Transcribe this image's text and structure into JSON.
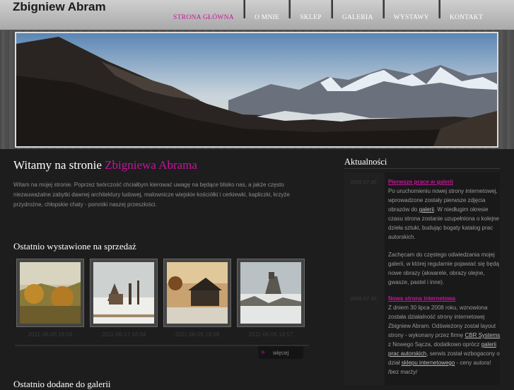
{
  "site": {
    "title": "Zbigniew Abram"
  },
  "nav": {
    "items": [
      {
        "label": "STRONA GŁÓWNA"
      },
      {
        "label": "O MNIE"
      },
      {
        "label": "SKLEP"
      },
      {
        "label": "GALERIA"
      },
      {
        "label": "WYSTAWY"
      },
      {
        "label": "KONTAKT"
      }
    ],
    "active_color": "#c5159a"
  },
  "main": {
    "heading_prefix": "Witamy na stronie ",
    "heading_highlight": "Zbigniewa Abrama",
    "intro": "Witam na mojej stronie. Poprzez twórczość chciałbym kierować uwagę na będące blisko nas, a jakże często niezauważalne zabytki dawnej architektury ludowej, malownicze wiejskie kościółki i cerkiewki, kapliczki, krzyże przydrożne, chłopskie chaty - pomniki naszej przeszłości.",
    "sale_heading": "Ostatnio wystawione na sprzedaż",
    "thumbs": [
      {
        "date": "2011-06-05 18:59"
      },
      {
        "date": "2011-06-17 16:34"
      },
      {
        "date": "2011-06-05 18:58"
      },
      {
        "date": "2011-06-05 18:57"
      }
    ],
    "more_label": "więcej",
    "recent_heading": "Ostatnio dodane do galerii"
  },
  "news": {
    "heading": "Aktualności",
    "items": [
      {
        "date": "2008.07.30",
        "title": "Pierwsze prace w galerii",
        "p1_a": "Po uruchomieniu nowej strony internetowej, wprowadzone zostały pierwsze zdjęcia obrazów do ",
        "p1_link": "galerii",
        "p1_b": ". W niedługim okresie czasu strona zostanie uzupełniona o kolejne dzieła sztuki, budując bogaty katalog prac autorskich.",
        "p2": "Zachęcam do częstego odwiedzania mojej galerii, w której regularnie pojawiać się będą nowe obrazy (akwarele, obrazy olejne, gwasze, pastel i inne)."
      },
      {
        "date": "2008.07.30",
        "title": "Nowa strona internetowa",
        "p1_a": "Z dniem 30 lipca 2008 roku, wznowiona została działalność strony internetowej Zbigniew Abram. Odświeżony został layout strony - wykonany przez firmę ",
        "link1": "CBR Systems",
        "p1_b": " z Nowego Sącza, dodatkowo oprócz ",
        "link2": "galerii prac autorskich",
        "p1_c": ", serwis został wzbogacony o dział ",
        "link3": "sklepu internetowego",
        "p1_d": " - ceny autora! /bez marży/"
      }
    ]
  }
}
